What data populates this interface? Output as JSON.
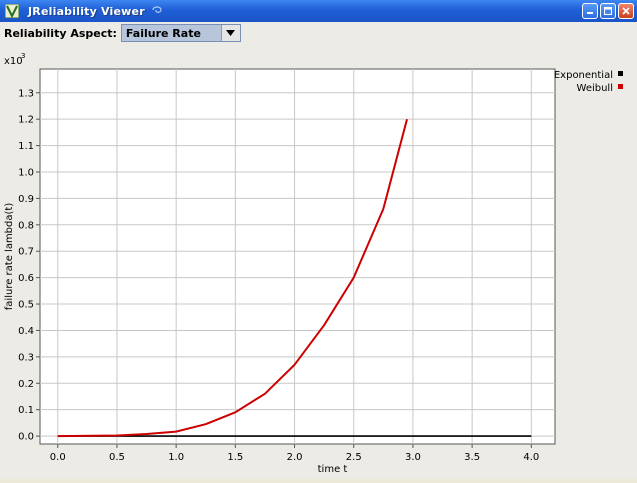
{
  "window": {
    "title": "JReliability Viewer"
  },
  "toolbar": {
    "label": "Reliability Aspect:",
    "selected": "Failure Rate"
  },
  "colors": {
    "title_bar": "#2563d9",
    "weibull": "#cc0000",
    "exponential": "#000000",
    "plot_bg": "#ffffff"
  },
  "icons": [
    "app-logo-icon",
    "minimize-icon",
    "maximize-icon",
    "close-icon",
    "dropdown-arrow-icon"
  ],
  "chart_data": {
    "type": "line",
    "xlabel": "time t",
    "ylabel": "failure rate lambda(t)",
    "y_multiplier_label": "x10",
    "y_multiplier_exp": "3",
    "xlim": [
      -0.15,
      4.2
    ],
    "ylim": [
      -0.03,
      1.39
    ],
    "grid": true,
    "legend_position": "top-right",
    "x_ticks": [
      "0.0",
      "0.5",
      "1.0",
      "1.5",
      "2.0",
      "2.5",
      "3.0",
      "3.5",
      "4.0"
    ],
    "y_ticks": [
      "0.0",
      "0.1",
      "0.2",
      "0.3",
      "0.4",
      "0.5",
      "0.6",
      "0.7",
      "0.8",
      "0.9",
      "1.0",
      "1.1",
      "1.2",
      "1.3"
    ],
    "series": [
      {
        "name": "Exponential",
        "x": [
          0.0,
          4.0
        ],
        "y": [
          0.0,
          0.0
        ]
      },
      {
        "name": "Weibull",
        "x": [
          0.0,
          0.5,
          0.75,
          1.0,
          1.25,
          1.5,
          1.75,
          2.0,
          2.25,
          2.5,
          2.75,
          2.95
        ],
        "y": [
          0.0,
          0.002,
          0.008,
          0.017,
          0.045,
          0.09,
          0.16,
          0.27,
          0.42,
          0.6,
          0.86,
          1.2
        ]
      }
    ]
  }
}
